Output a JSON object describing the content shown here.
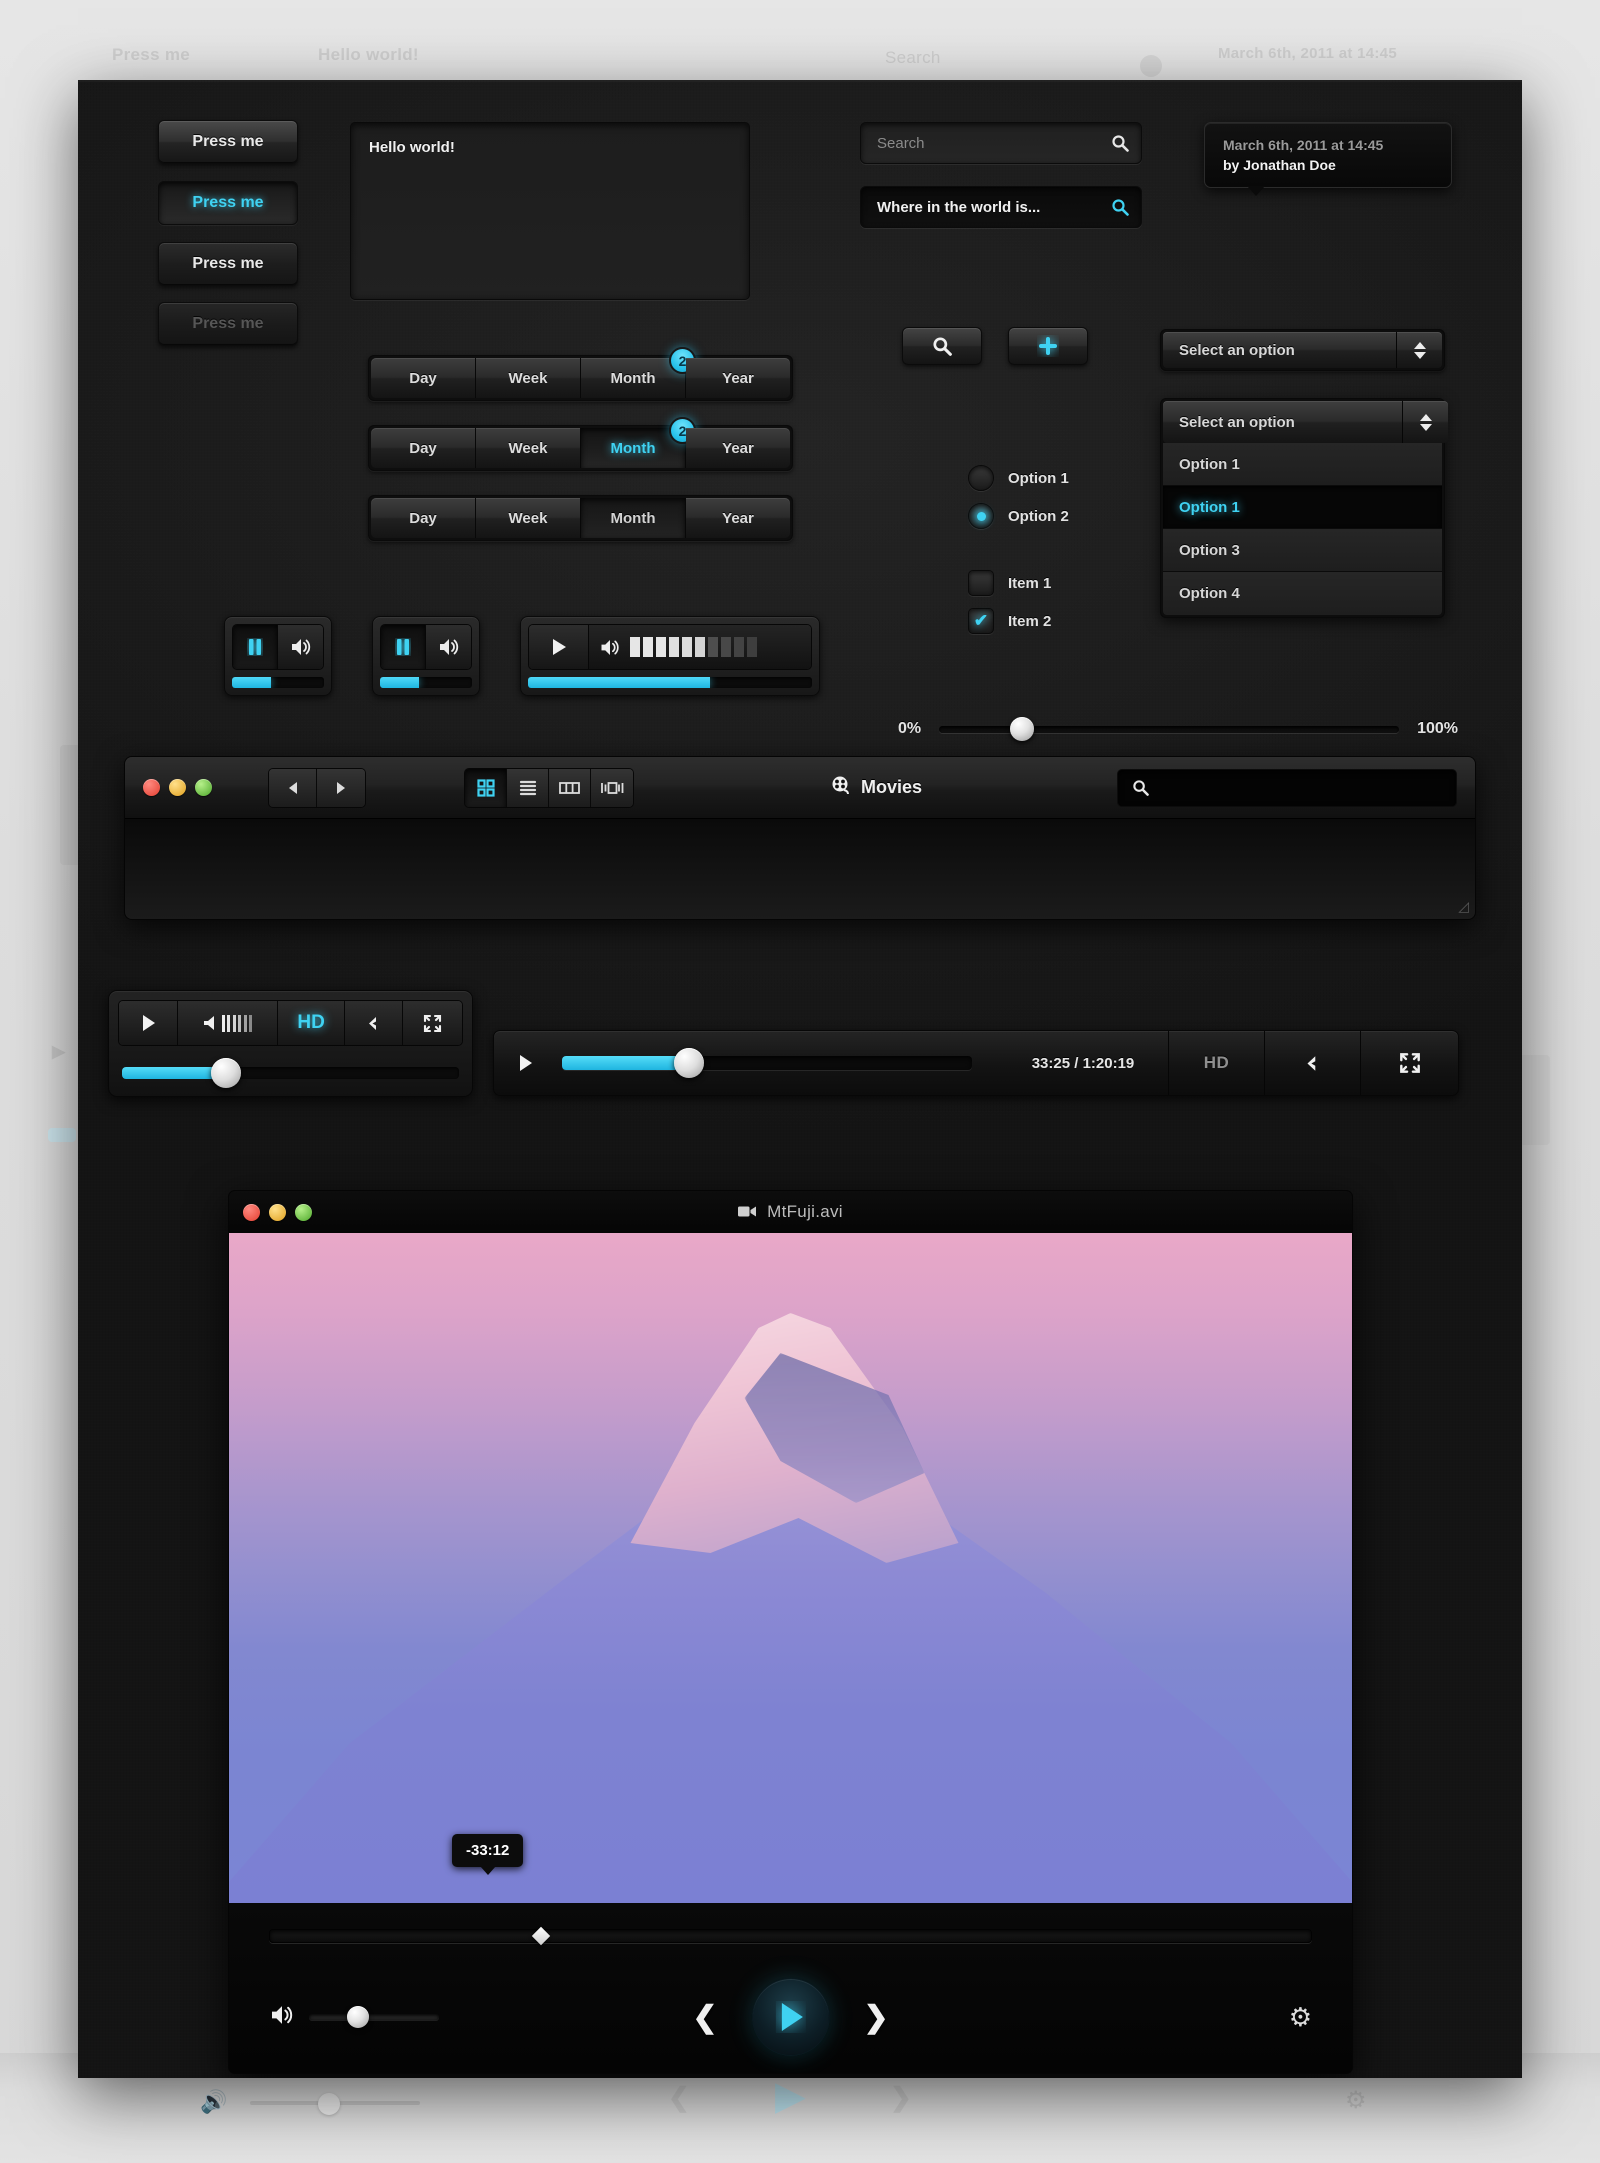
{
  "buttons": {
    "normal": "Press me",
    "pressed": "Press me",
    "flat": "Press me",
    "disabled": "Press me"
  },
  "textarea": {
    "value": "Hello world!"
  },
  "segmented": {
    "rows": [
      {
        "items": [
          "Day",
          "Week",
          "Month",
          "Year"
        ],
        "active": -1,
        "badge_index": 2,
        "badge": "2",
        "style": "normal"
      },
      {
        "items": [
          "Day",
          "Week",
          "Month",
          "Year"
        ],
        "active": 2,
        "badge_index": 2,
        "badge": "2",
        "style": "glow"
      },
      {
        "items": [
          "Day",
          "Week",
          "Month",
          "Year"
        ],
        "active": 2,
        "badge_index": -1,
        "badge": "",
        "style": "dark"
      }
    ]
  },
  "search": {
    "placeholder": "Search",
    "filled_value": "Where in the world is...",
    "icon": "search-icon"
  },
  "note": {
    "line1": "March 6th, 2011 at 14:45",
    "line2": "by Jonathan Doe"
  },
  "icon_buttons": {
    "search": "search-icon",
    "add": "plus-icon"
  },
  "select": {
    "closed_label": "Select an option",
    "open_label": "Select an option",
    "options": [
      "Option 1",
      "Option 1",
      "Option 3",
      "Option 4"
    ],
    "selected_index": 1
  },
  "radios": [
    {
      "label": "Option 1",
      "checked": false
    },
    {
      "label": "Option 2",
      "checked": true
    }
  ],
  "checkboxes": [
    {
      "label": "Item 1",
      "checked": false
    },
    {
      "label": "Item 2",
      "checked": true,
      "glyph": "✔"
    }
  ],
  "mini_players": [
    {
      "buttons": [
        "pause-icon",
        "volume-icon"
      ],
      "progress_pct": 42
    },
    {
      "buttons": [
        "pause-icon",
        "volume-icon"
      ],
      "progress_pct": 42
    },
    {
      "buttons": [
        "play-icon",
        "volume-icon"
      ],
      "progress_pct": 64,
      "volume_bars_total": 10,
      "volume_bars_on": 6
    }
  ],
  "slider": {
    "min_label": "0%",
    "max_label": "100%",
    "value_pct": 18
  },
  "finder_window": {
    "title": "Movies",
    "title_icon": "film-reel-icon",
    "traffic_lights": [
      "close-icon",
      "minimize-icon",
      "zoom-icon"
    ],
    "nav": [
      "back-icon",
      "forward-icon"
    ],
    "views": [
      "icon-view-icon",
      "list-view-icon",
      "column-view-icon",
      "coverflow-view-icon"
    ],
    "active_view": 0,
    "search_placeholder": "",
    "search_icon": "search-icon"
  },
  "small_player": {
    "controls": [
      "play-icon",
      "volume-icon",
      "HD",
      "share-icon",
      "fullscreen-icon"
    ],
    "hd_label": "HD",
    "progress_pct": 32
  },
  "wide_player": {
    "play_icon": "play-icon",
    "progress_pct": 31,
    "timecode": "33:25 / 1:20:19",
    "hd_label": "HD",
    "share_icon": "share-icon",
    "fullscreen_icon": "fullscreen-icon"
  },
  "fuji_window": {
    "title": "MtFuji.avi",
    "title_icon": "video-camera-icon",
    "traffic_lights": [
      "close-icon",
      "minimize-icon",
      "zoom-icon"
    ],
    "tooltip_time": "-33:12",
    "scrub_pct": 26,
    "volume_icon": "volume-icon",
    "volume_pct": 38,
    "prev_icon": "chevron-left-icon",
    "play_icon": "play-icon",
    "next_icon": "chevron-right-icon",
    "settings_icon": "gear-icon"
  },
  "colors": {
    "accent": "#3fd2f2",
    "panel_bg": "#1b1b1b",
    "page_bg": "#e2e2e2",
    "badge": "#29c3ec"
  }
}
